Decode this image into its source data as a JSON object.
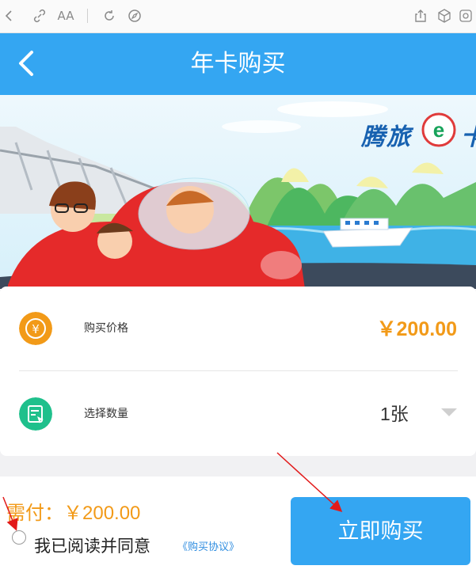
{
  "browser": {
    "icons": [
      "back-icon",
      "link-icon",
      "text-size-icon",
      "refresh-icon",
      "compass-icon",
      "share-icon",
      "box-icon",
      "settings-icon"
    ],
    "text_size_glyph": "AA"
  },
  "header": {
    "title": "年卡购买",
    "background": "#34a6f2"
  },
  "banner": {
    "brand_text": "腾旅",
    "brand_e": "e",
    "brand_suffix": "卡"
  },
  "card": {
    "price_label": "购买价格",
    "price_value": "￥200.00",
    "quantity_label": "选择数量",
    "quantity_value": "1张",
    "price_icon": "yuan-icon",
    "quantity_icon": "select-icon",
    "yuan_glyph": "¥"
  },
  "footer": {
    "pay_label": "需付：￥200.00",
    "agree_text": "我已阅读并同意",
    "agreement_link": "《购买协议》",
    "buy_button": "立即购买",
    "accent": "#f29a18"
  }
}
